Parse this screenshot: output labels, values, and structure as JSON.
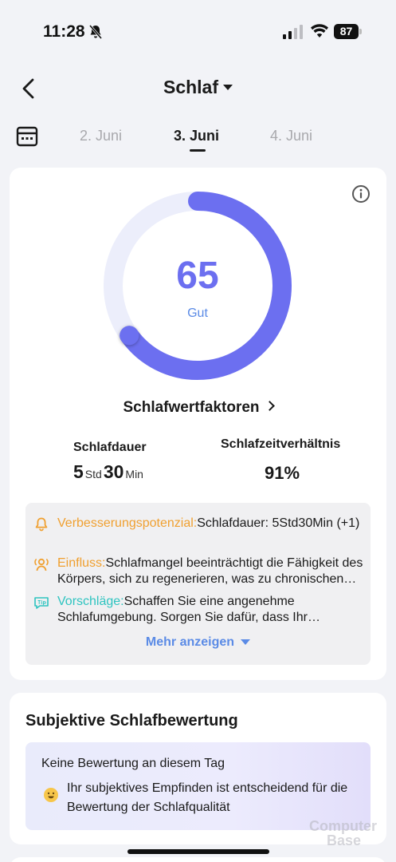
{
  "status_bar": {
    "time": "11:28",
    "battery": "87"
  },
  "header": {
    "title": "Schlaf"
  },
  "dates": {
    "prev": "2. Juni",
    "current": "3. Juni",
    "next": "4. Juni"
  },
  "score": {
    "value": "65",
    "label": "Gut",
    "fraction": 0.65,
    "color": "#6c6ff0",
    "track_color": "#eceefb"
  },
  "factors_link": "Schlafwertfaktoren",
  "metrics": {
    "duration_label": "Schlafdauer",
    "duration_hours": "5",
    "duration_hours_unit": "Std",
    "duration_minutes": "30",
    "duration_minutes_unit": "Min",
    "ratio_label": "Schlafzeitverhältnis",
    "ratio_value": "91%"
  },
  "insights": [
    {
      "icon": "bell-icon",
      "tag": "Verbesserungspotenzial:",
      "text": "Schlafdauer: 5Std30Min (+1)"
    },
    {
      "icon": "person-broadcast-icon",
      "tag": "Einfluss:",
      "text": "Schlafmangel beeinträchtigt die Fähigkeit des Körpers, sich zu regenerieren, was zu chronischen Problemen führen kann"
    },
    {
      "icon": "tips-icon",
      "tag": "Vorschläge:",
      "text": "Schaffen Sie eine angenehme Schlafumgebung. Sorgen Sie dafür, dass Ihr Schlafzimmer ruhig ist"
    }
  ],
  "more_link": "Mehr anzeigen",
  "subjective": {
    "title": "Subjektive Schlafbewertung",
    "none": "Keine Bewertung an diesem Tag",
    "text": "Ihr subjektives Empfinden ist entscheidend für die Bewertung der Schlafqualität"
  },
  "watermark": {
    "line1": "Computer",
    "line2": "Base"
  }
}
